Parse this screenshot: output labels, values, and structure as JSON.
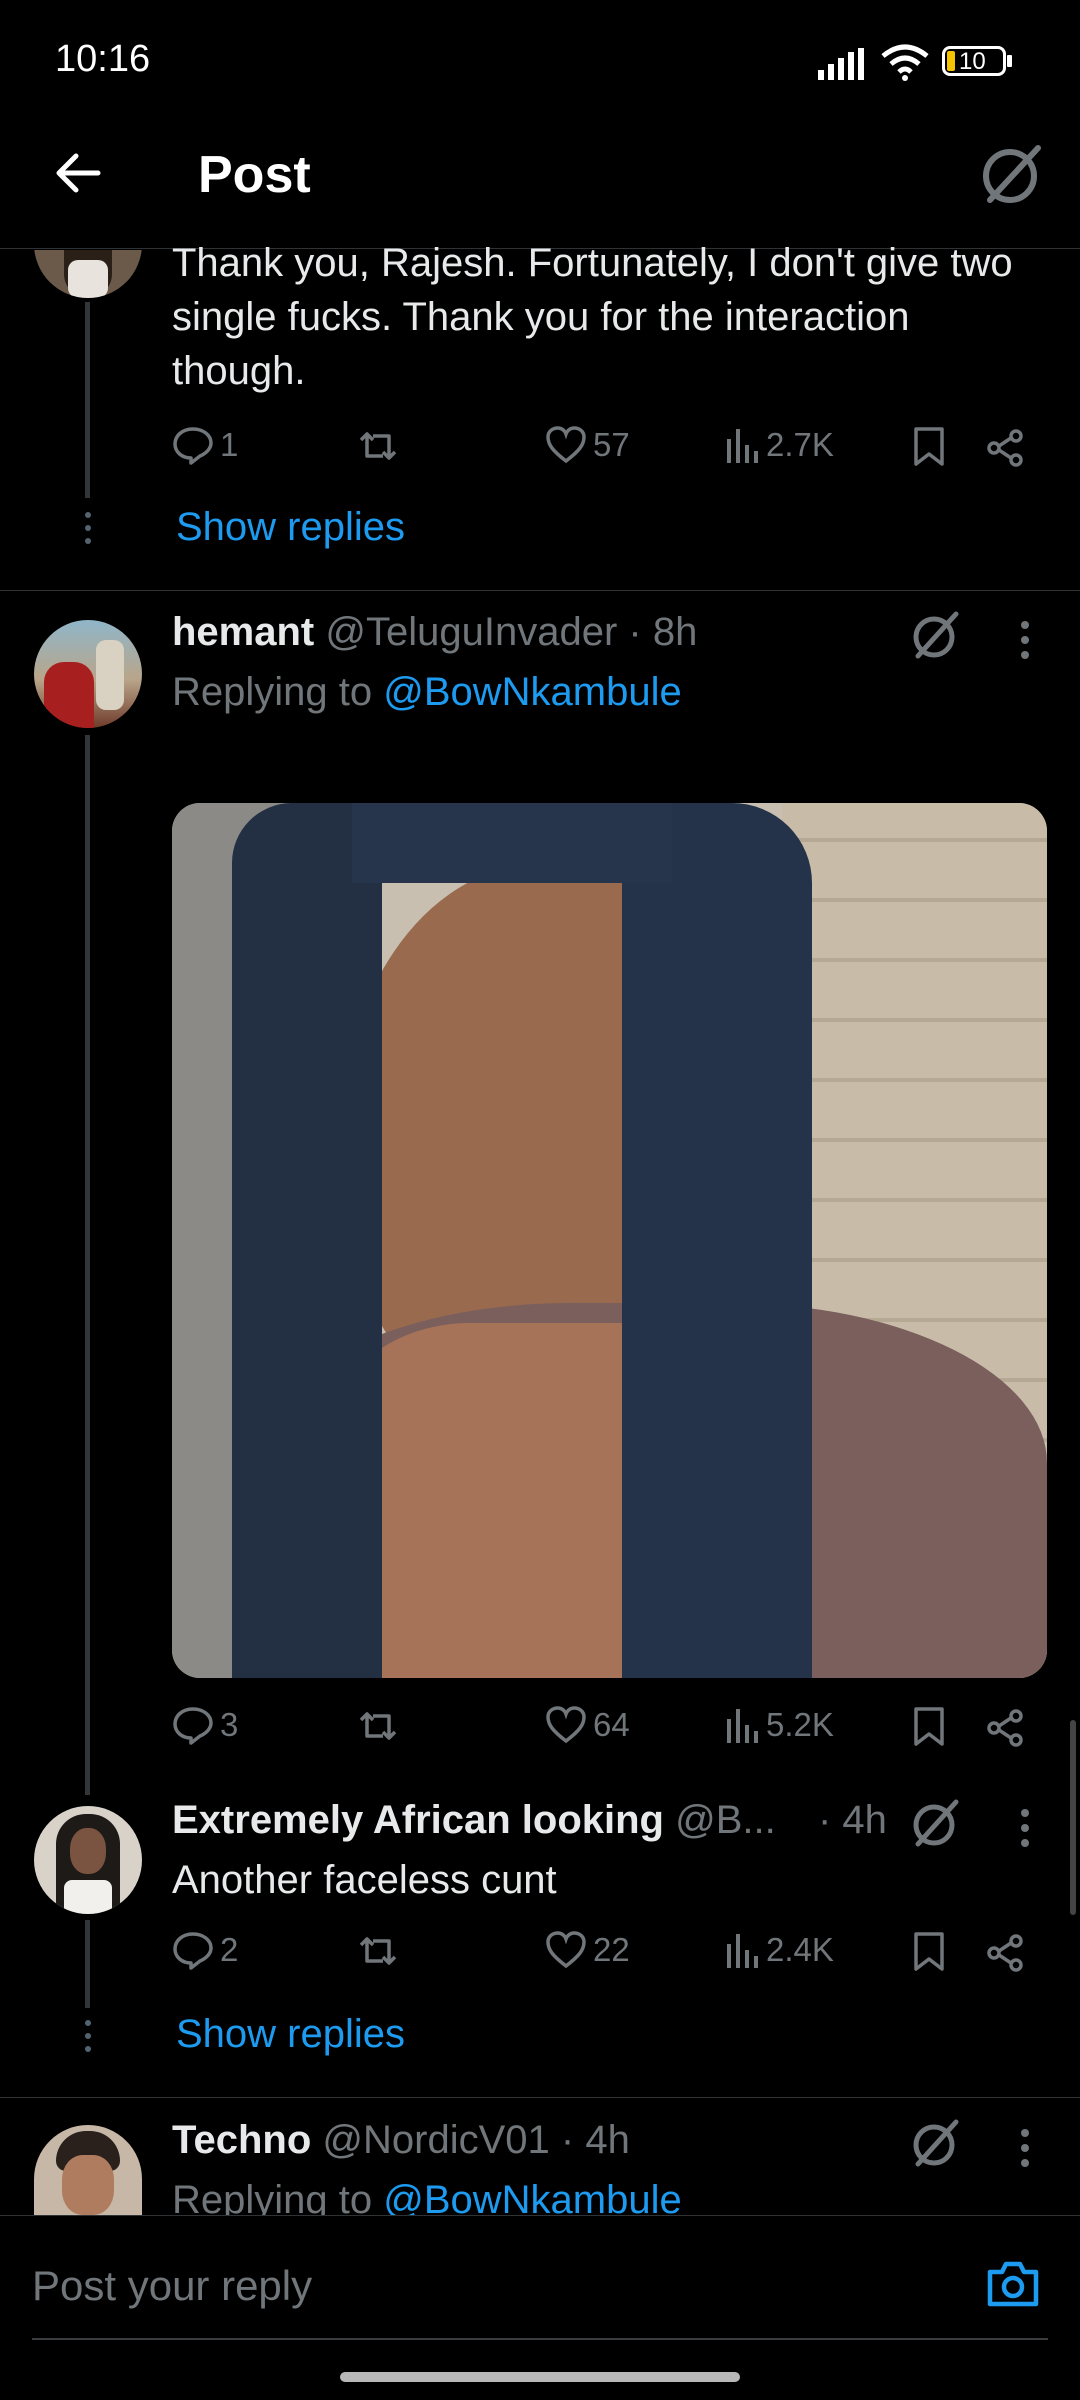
{
  "status_bar": {
    "time": "10:16",
    "battery": "10"
  },
  "header": {
    "title": "Post"
  },
  "post_top": {
    "text": "Thank you, Rajesh. Fortunately, I don't give two single fucks. Thank you for the interaction though.",
    "reply_count": "1",
    "like_count": "57",
    "view_count": "2.7K",
    "show_replies": "Show replies"
  },
  "post_hemant": {
    "name": "hemant",
    "handle": "@TeluguInvader",
    "time": "· 8h",
    "replying_to_prefix": "Replying to ",
    "replying_to": "@BowNkambule",
    "reply_count": "3",
    "like_count": "64",
    "view_count": "5.2K"
  },
  "post_african": {
    "name": "Extremely African looking",
    "handle": "@B...",
    "time": "· 4h",
    "text": "Another faceless cunt",
    "reply_count": "2",
    "like_count": "22",
    "view_count": "2.4K",
    "show_replies": "Show replies"
  },
  "post_techno": {
    "name": "Techno",
    "handle": "@NordicV01",
    "time": "· 4h",
    "replying_to_prefix": "Replying to ",
    "replying_to": "@BowNkambule"
  },
  "reply_bar": {
    "placeholder": "Post your reply"
  },
  "colors": {
    "accent": "#1d9bf0",
    "muted": "#71767b",
    "background": "#000000"
  }
}
